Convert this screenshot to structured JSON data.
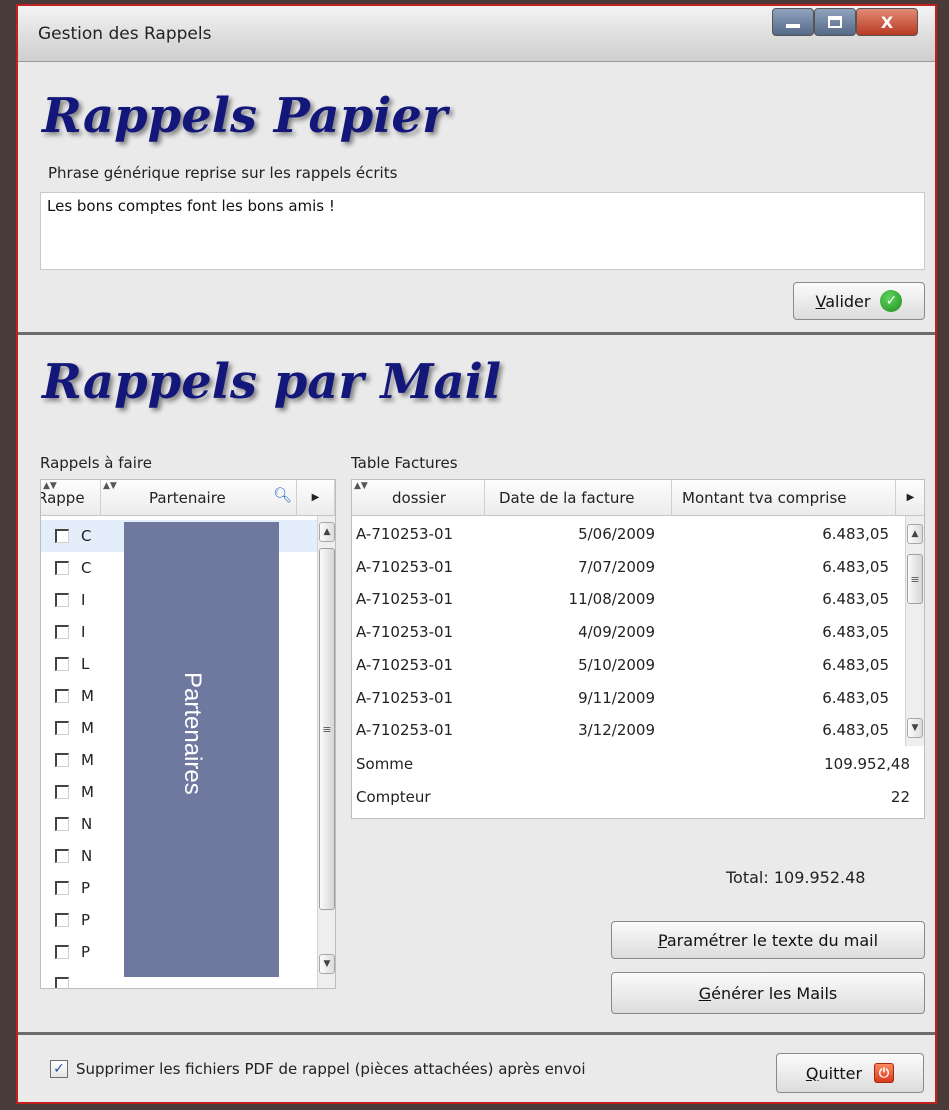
{
  "window": {
    "title": "Gestion des Rappels"
  },
  "paper": {
    "heading": "Rappels Papier",
    "field_label": "Phrase générique reprise sur les rappels écrits",
    "text": "Les bons comptes font les bons amis !",
    "validate_label": "Valider",
    "validate_mnemonic": "V",
    "validate_rest": "alider"
  },
  "mail": {
    "heading": "Rappels par Mail",
    "left_label": "Rappels à faire",
    "right_label": "Table Factures",
    "left_columns": [
      "Rappe",
      "Partenaire"
    ],
    "left_rows": [
      {
        "initial": "C"
      },
      {
        "initial": "C"
      },
      {
        "initial": "I"
      },
      {
        "initial": "I"
      },
      {
        "initial": "L"
      },
      {
        "initial": "M"
      },
      {
        "initial": "M"
      },
      {
        "initial": "M"
      },
      {
        "initial": "M"
      },
      {
        "initial": "N"
      },
      {
        "initial": "N"
      },
      {
        "initial": "P"
      },
      {
        "initial": "P"
      },
      {
        "initial": "P"
      },
      {
        "initial": ""
      }
    ],
    "redaction_label": "Partenaires",
    "right_columns": [
      "dossier",
      "Date de la facture",
      "Montant tva comprise"
    ],
    "invoices": [
      {
        "dossier": "A-710253-01",
        "date": "5/06/2009",
        "montant": "6.483,05"
      },
      {
        "dossier": "A-710253-01",
        "date": "7/07/2009",
        "montant": "6.483,05"
      },
      {
        "dossier": "A-710253-01",
        "date": "11/08/2009",
        "montant": "6.483,05"
      },
      {
        "dossier": "A-710253-01",
        "date": "4/09/2009",
        "montant": "6.483,05"
      },
      {
        "dossier": "A-710253-01",
        "date": "5/10/2009",
        "montant": "6.483,05"
      },
      {
        "dossier": "A-710253-01",
        "date": "9/11/2009",
        "montant": "6.483,05"
      },
      {
        "dossier": "A-710253-01",
        "date": "3/12/2009",
        "montant": "6.483,05"
      }
    ],
    "somme_label": "Somme",
    "somme_value": "109.952,48",
    "compteur_label": "Compteur",
    "compteur_value": "22",
    "total_text": "Total:  109.952.48",
    "param_mnemonic": "P",
    "param_rest": "aramétrer le texte du mail",
    "generate_mnemonic": "G",
    "generate_rest": "énérer les Mails"
  },
  "footer": {
    "delete_pdf_label": "Supprimer les fichiers PDF de rappel (pièces attachées) après envoi",
    "delete_pdf_checked": true,
    "quit_mnemonic": "Q",
    "quit_rest": "uitter"
  }
}
